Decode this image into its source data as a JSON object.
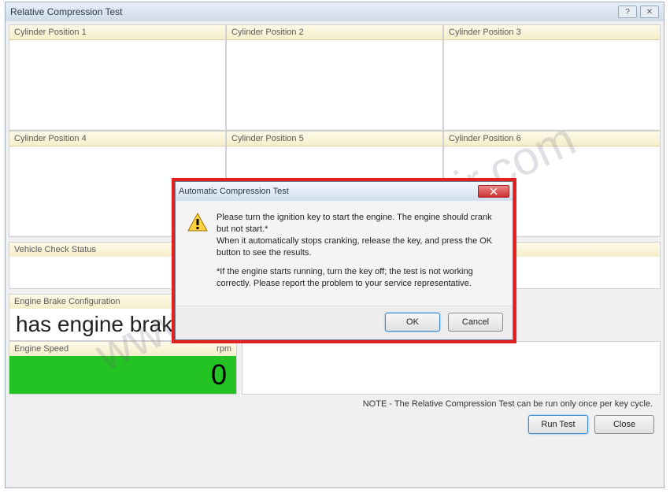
{
  "window": {
    "title": "Relative Compression Test"
  },
  "cylinders": [
    "Cylinder Position 1",
    "Cylinder Position 2",
    "Cylinder Position 3",
    "Cylinder Position 4",
    "Cylinder Position 5",
    "Cylinder Position 6"
  ],
  "vehicle_check": {
    "header": "Vehicle Check Status"
  },
  "engine_brake": {
    "header": "Engine Brake Configuration",
    "value": "has engine brake"
  },
  "engine_speed": {
    "label": "Engine Speed",
    "unit": "rpm",
    "value": "0"
  },
  "note": "NOTE - The Relative Compression Test can be run only once per key cycle.",
  "buttons": {
    "run": "Run Test",
    "close": "Close"
  },
  "modal": {
    "title": "Automatic Compression Test",
    "para1": "Please turn the ignition key to start the engine. The engine should crank but not start.*",
    "para2": "When it automatically stops cranking, release the key, and press the OK button to see the results.",
    "para3": "*If the engine starts running, turn the key off; the test is not working correctly. Please report the problem to your service representative.",
    "ok": "OK",
    "cancel": "Cancel"
  },
  "watermark": "www.car-auto-repair.com"
}
